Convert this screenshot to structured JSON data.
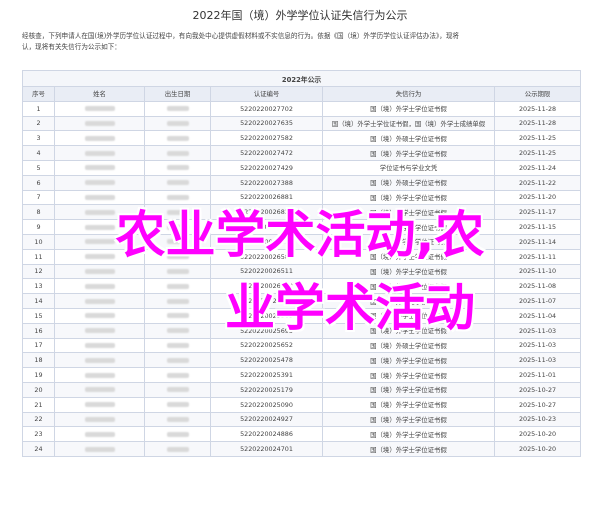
{
  "page": {
    "title": "2022年国（境）外学学位认证失信行为公示",
    "intro": [
      "经核查，下列申请人在国(境)外学历学位认证过程中，有向我处中心提供虚假材料或不实信息的行为。依据《国（境）外学历学位认证评估办法》，现将",
      "认，现将有关失信行为公示如下："
    ]
  },
  "table": {
    "caption": "2022年公示",
    "headers": [
      "序号",
      "姓名",
      "出生日期",
      "认证编号",
      "失信行为",
      "公示期限"
    ],
    "rows": [
      {
        "no": "1",
        "id": "5220220027702",
        "act": "国（境）外学士学位证书假",
        "until": "2025-11-28"
      },
      {
        "no": "2",
        "id": "5220220027635",
        "act": "国（境）外学士学位证书假，国（境）外学士成绩单假",
        "until": "2025-11-28"
      },
      {
        "no": "3",
        "id": "5220220027582",
        "act": "国（境）外硕士学位证书假",
        "until": "2025-11-25"
      },
      {
        "no": "4",
        "id": "5220220027472",
        "act": "国（境）外学士学位证书假",
        "until": "2025-11-25"
      },
      {
        "no": "5",
        "id": "5220220027429",
        "act": "学位证书与学业文凭",
        "until": "2025-11-24"
      },
      {
        "no": "6",
        "id": "5220220027388",
        "act": "国（境）外硕士学位证书假",
        "until": "2025-11-22"
      },
      {
        "no": "7",
        "id": "5220220026881",
        "act": "国（境）外学士学位证书假",
        "until": "2025-11-20"
      },
      {
        "no": "8",
        "id": "5220220026824",
        "act": "国（境）外学士学位证书假",
        "until": "2025-11-17"
      },
      {
        "no": "9",
        "id": "5220220026706",
        "act": "国（境）外学士学位证书假",
        "until": "2025-11-15"
      },
      {
        "no": "10",
        "id": "5220220026610",
        "act": "国（境）外学士学位证书假",
        "until": "2025-11-14"
      },
      {
        "no": "11",
        "id": "5220220026588",
        "act": "国（境）外学士学位证书假",
        "until": "2025-11-11"
      },
      {
        "no": "12",
        "id": "5220220026511",
        "act": "国（境）外学士学位证书假",
        "until": "2025-11-10"
      },
      {
        "no": "13",
        "id": "5220220026382",
        "act": "国（境）外学士学位证书假",
        "until": "2025-11-08"
      },
      {
        "no": "14",
        "id": "5220220026215",
        "act": "国（境）外学士学位证书假",
        "until": "2025-11-07"
      },
      {
        "no": "15",
        "id": "5220220025969",
        "act": "国（境）外学士学位证书假",
        "until": "2025-11-04"
      },
      {
        "no": "16",
        "id": "5220220025695",
        "act": "国（境）外学士学位证书假",
        "until": "2025-11-03"
      },
      {
        "no": "17",
        "id": "5220220025652",
        "act": "国（境）外硕士学位证书假",
        "until": "2025-11-03"
      },
      {
        "no": "18",
        "id": "5220220025478",
        "act": "国（境）外学士学位证书假",
        "until": "2025-11-03"
      },
      {
        "no": "19",
        "id": "5220220025391",
        "act": "国（境）外学士学位证书假",
        "until": "2025-11-01"
      },
      {
        "no": "20",
        "id": "5220220025179",
        "act": "国（境）外学士学位证书假",
        "until": "2025-10-27"
      },
      {
        "no": "21",
        "id": "5220220025090",
        "act": "国（境）外学士学位证书假",
        "until": "2025-10-27"
      },
      {
        "no": "22",
        "id": "5220220024927",
        "act": "国（境）外学士学位证书假",
        "until": "2025-10-23"
      },
      {
        "no": "23",
        "id": "5220220024886",
        "act": "国（境）外学士学位证书假",
        "until": "2025-10-20"
      },
      {
        "no": "24",
        "id": "5220220024701",
        "act": "国（境）外学士学位证书假",
        "until": "2025-10-20"
      }
    ]
  },
  "overlay": {
    "line1": "农业学术活动,农",
    "line2": "业学术活动",
    "color": "#ff00ff"
  }
}
